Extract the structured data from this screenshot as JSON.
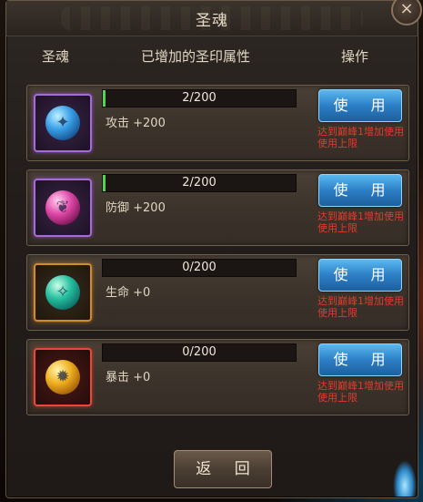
{
  "title": "圣魂",
  "close_label": "×",
  "headers": {
    "col1": "圣魂",
    "col2": "已增加的圣印属性",
    "col3": "操作"
  },
  "rows": [
    {
      "icon": "blue-soul-orb-icon",
      "progress": "2/200",
      "progress_fraction": 0.01,
      "attribute": "攻击 +200",
      "button": "使 用",
      "note": "达到巅峰1增加使用使用上限"
    },
    {
      "icon": "pink-soul-orb-icon",
      "progress": "2/200",
      "progress_fraction": 0.01,
      "attribute": "防御 +200",
      "button": "使 用",
      "note": "达到巅峰1增加使用使用上限"
    },
    {
      "icon": "teal-soul-orb-icon",
      "progress": "0/200",
      "progress_fraction": 0,
      "attribute": "生命 +0",
      "button": "使 用",
      "note": "达到巅峰1增加使用使用上限"
    },
    {
      "icon": "gold-soul-orb-icon",
      "progress": "0/200",
      "progress_fraction": 0,
      "attribute": "暴击 +0",
      "button": "使 用",
      "note": "达到巅峰1增加使用使用上限"
    }
  ],
  "back_label": "返 回",
  "colors": {
    "progress_fill": "#4bd64b",
    "button_blue": "#2c7fc6",
    "note_red": "#e23b2c"
  }
}
